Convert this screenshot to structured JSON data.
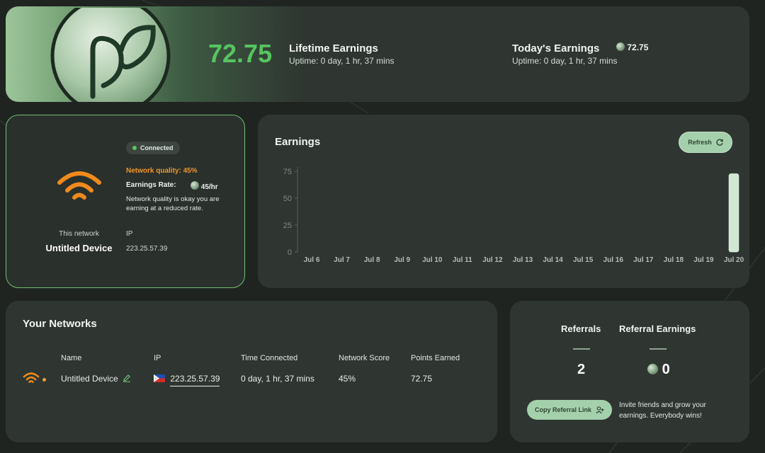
{
  "header": {
    "lifetime_value": "72.75",
    "lifetime_title": "Lifetime Earnings",
    "lifetime_uptime": "Uptime: 0 day, 1 hr, 37 mins",
    "today_title": "Today's Earnings",
    "today_value": "72.75",
    "today_uptime": "Uptime: 0 day, 1 hr, 37 mins"
  },
  "device": {
    "status": "Connected",
    "quality": "Network quality: 45%",
    "rate_label": "Earnings Rate:",
    "rate_value": "45/hr",
    "note": "Network quality is okay you are earning at a reduced rate.",
    "this_network_label": "This network",
    "name": "Untitled Device",
    "ip_label": "IP",
    "ip": "223.25.57.39",
    "wifi_color": "#f08a1c"
  },
  "earnings": {
    "title": "Earnings",
    "refresh_label": "Refresh"
  },
  "chart_data": {
    "type": "bar",
    "categories": [
      "Jul 6",
      "Jul 7",
      "Jul 8",
      "Jul 9",
      "Jul 10",
      "Jul 11",
      "Jul 12",
      "Jul 13",
      "Jul 14",
      "Jul 15",
      "Jul 16",
      "Jul 17",
      "Jul 18",
      "Jul 19",
      "Jul 20"
    ],
    "values": [
      0,
      0,
      0,
      0,
      0,
      0,
      0,
      0,
      0,
      0,
      0,
      0,
      0,
      0,
      72.75
    ],
    "yticks": [
      "0",
      "25",
      "50",
      "75"
    ],
    "ylim": [
      0,
      75
    ],
    "title": "",
    "xlabel": "",
    "ylabel": "",
    "grid": false,
    "bar_color": "#cfe8d2"
  },
  "networks": {
    "title": "Your Networks",
    "columns": [
      "Name",
      "IP",
      "Time Connected",
      "Network Score",
      "Points Earned"
    ],
    "rows": [
      {
        "name": "Untitled Device",
        "ip": "223.25.57.39",
        "time": "0 day, 1 hr, 37 mins",
        "score": "45%",
        "points": "72.75"
      }
    ]
  },
  "referrals": {
    "referrals_label": "Referrals",
    "referrals_value": "2",
    "earnings_label": "Referral Earnings",
    "earnings_value": "0",
    "copy_label": "Copy Referral Link",
    "invite_text": "Invite friends and grow your earnings. Everybody wins!"
  }
}
